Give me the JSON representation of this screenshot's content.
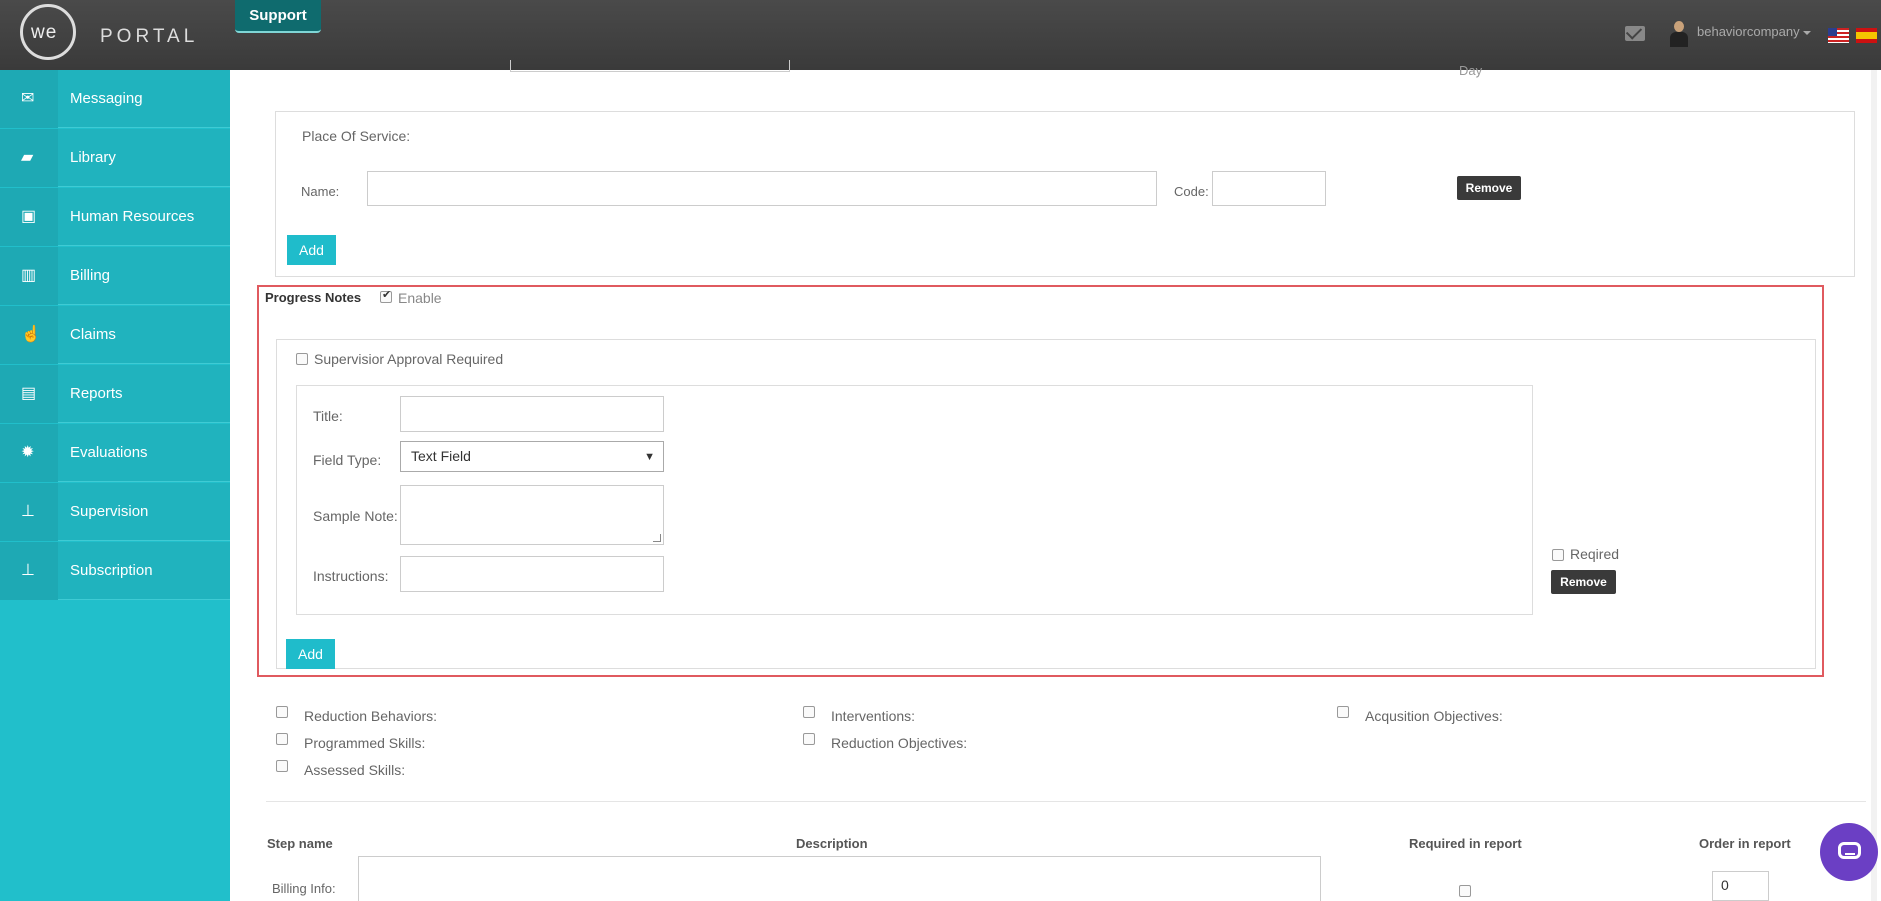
{
  "header": {
    "logo_we": "we",
    "logo_portal": "PORTAL",
    "support_label": "Support",
    "username": "behaviorcompany"
  },
  "sidebar": {
    "items": [
      {
        "label": "Messaging",
        "icon": "envelope-icon",
        "glyph": "✉"
      },
      {
        "label": "Library",
        "icon": "folder-open-icon",
        "glyph": "▰"
      },
      {
        "label": "Human Resources",
        "icon": "briefcase-icon",
        "glyph": "▣"
      },
      {
        "label": "Billing",
        "icon": "bar-chart-icon",
        "glyph": "▥"
      },
      {
        "label": "Claims",
        "icon": "hand-pointer-icon",
        "glyph": "☝"
      },
      {
        "label": "Reports",
        "icon": "book-icon",
        "glyph": "▤"
      },
      {
        "label": "Evaluations",
        "icon": "certificate-icon",
        "glyph": "✹"
      },
      {
        "label": "Supervision",
        "icon": "sitemap-icon",
        "glyph": "⊥"
      },
      {
        "label": "Subscription",
        "icon": "sitemap-icon",
        "glyph": "⊥"
      }
    ]
  },
  "top_partial": {
    "day_label": "Day"
  },
  "place_of_service": {
    "heading": "Place Of Service:",
    "name_label": "Name:",
    "name_value": "",
    "code_label": "Code:",
    "code_value": "",
    "remove_label": "Remove",
    "add_label": "Add"
  },
  "progress_notes": {
    "heading": "Progress Notes",
    "enable_label": "Enable",
    "enable_checked": true,
    "supervisor_label": "Supervisior Approval Required",
    "title_label": "Title:",
    "title_value": "",
    "field_type_label": "Field Type:",
    "field_type_value": "Text Field",
    "sample_note_label": "Sample Note:",
    "sample_note_value": "",
    "instructions_label": "Instructions:",
    "instructions_value": "",
    "required_label": "Reqired",
    "remove_label": "Remove",
    "add_label": "Add"
  },
  "options": {
    "reduction_behaviors": "Reduction Behaviors:",
    "programmed_skills": "Programmed Skills:",
    "assessed_skills": "Assessed Skills:",
    "interventions": "Interventions:",
    "reduction_objectives": "Reduction Objectives:",
    "acquisition_objectives": "Acqusition Objectives:"
  },
  "steps_table": {
    "col_step_name": "Step name",
    "col_description": "Description",
    "col_required": "Required in report",
    "col_order": "Order in report",
    "row_label": "Billing Info:",
    "order_value": "0"
  }
}
